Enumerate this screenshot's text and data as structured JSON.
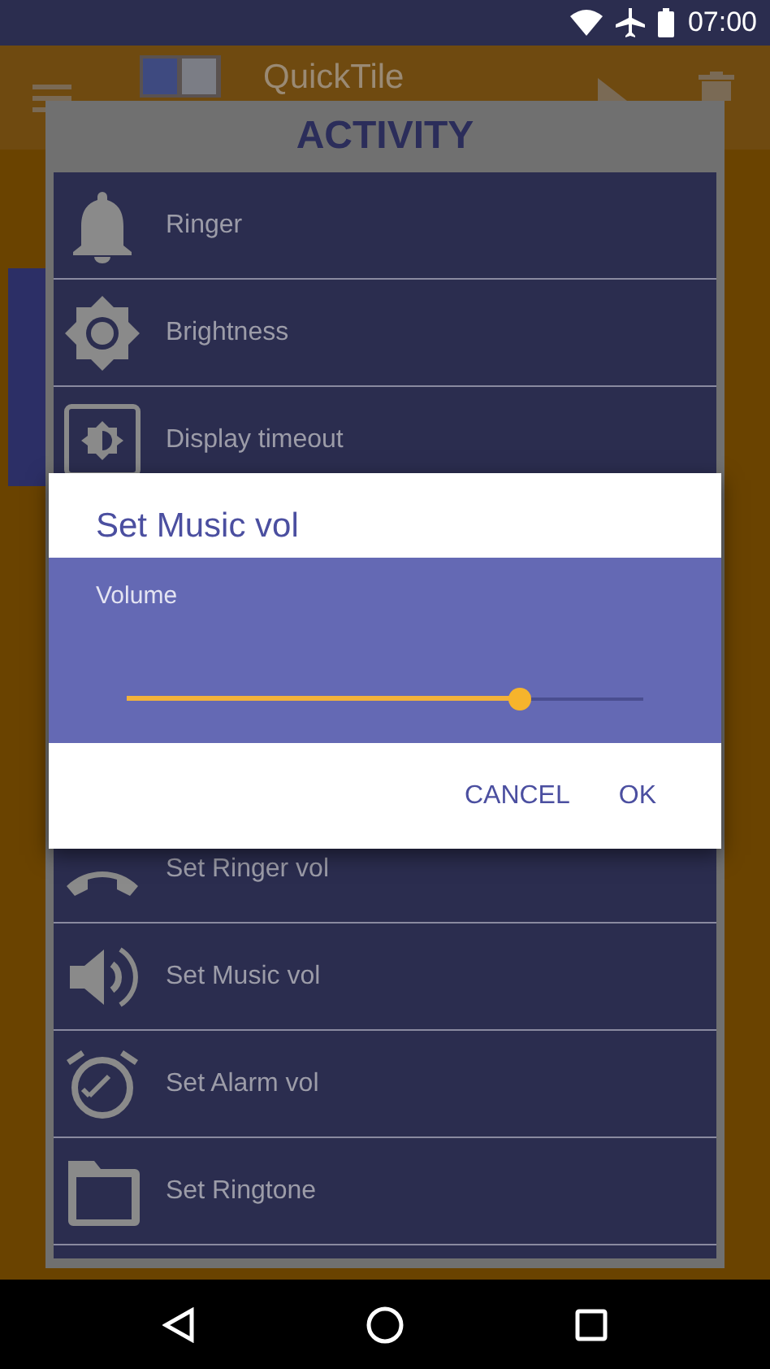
{
  "status_bar": {
    "time": "07:00"
  },
  "app_bar": {
    "title": "QuickTile"
  },
  "activity": {
    "title": "ACTIVITY",
    "items": [
      {
        "label": "Ringer"
      },
      {
        "label": "Brightness"
      },
      {
        "label": "Display timeout"
      }
    ],
    "items_below_dialog": [
      {
        "label": "Set Ringer vol"
      },
      {
        "label": "Set Music vol"
      },
      {
        "label": "Set Alarm vol"
      },
      {
        "label": "Set Ringtone"
      }
    ]
  },
  "dialog": {
    "title": "Set Music vol",
    "label": "Volume",
    "level": 0.76,
    "buttons": [
      "CANCEL",
      "OK"
    ]
  }
}
